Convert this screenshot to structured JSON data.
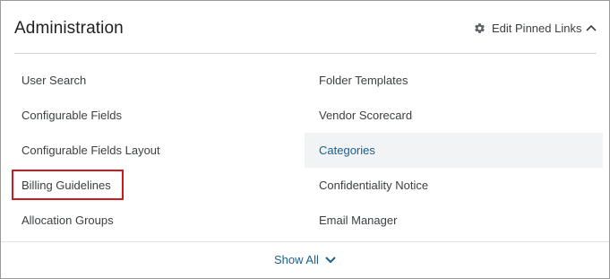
{
  "panel": {
    "title": "Administration",
    "edit_pinned_label": "Edit Pinned Links",
    "edit_pinned_icon": "gear-icon",
    "collapse_icon": "chevron-up-icon"
  },
  "links": {
    "left": [
      {
        "label": "User Search"
      },
      {
        "label": "Configurable Fields"
      },
      {
        "label": "Configurable Fields Layout"
      },
      {
        "label": "Billing Guidelines"
      },
      {
        "label": "Allocation Groups"
      }
    ],
    "right": [
      {
        "label": "Folder Templates"
      },
      {
        "label": "Vendor Scorecard"
      },
      {
        "label": "Categories"
      },
      {
        "label": "Confidentiality Notice"
      },
      {
        "label": "Email Manager"
      }
    ]
  },
  "footer": {
    "show_all_label": "Show All",
    "show_all_icon": "chevron-down-icon"
  },
  "colors": {
    "link_active": "#1a5f8e",
    "highlight_border": "#d0191d"
  }
}
